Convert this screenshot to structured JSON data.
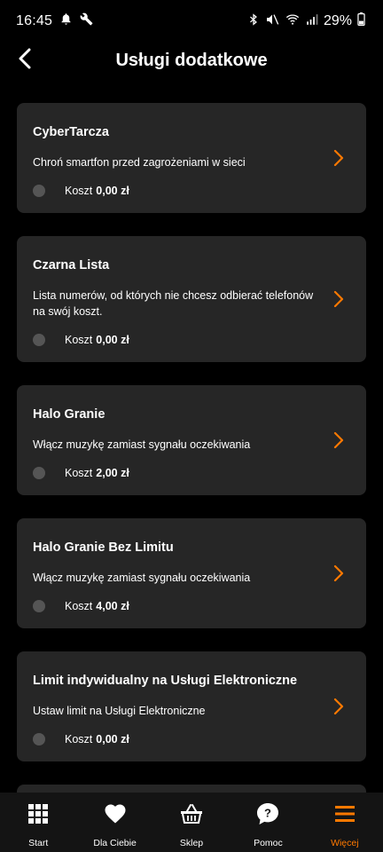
{
  "status_bar": {
    "time": "16:45",
    "battery": "29%"
  },
  "header": {
    "title": "Usługi dodatkowe"
  },
  "services": [
    {
      "title": "CyberTarcza",
      "description": "Chroń smartfon przed zagrożeniami w sieci",
      "cost_label": "Koszt",
      "cost_value": "0,00 zł"
    },
    {
      "title": "Czarna Lista",
      "description": "Lista numerów, od których nie chcesz odbierać telefonów na swój koszt.",
      "cost_label": "Koszt",
      "cost_value": "0,00 zł"
    },
    {
      "title": "Halo Granie",
      "description": "Włącz muzykę zamiast sygnału oczekiwania",
      "cost_label": "Koszt",
      "cost_value": "2,00 zł"
    },
    {
      "title": "Halo Granie Bez Limitu",
      "description": "Włącz muzykę zamiast sygnału oczekiwania",
      "cost_label": "Koszt",
      "cost_value": "4,00 zł"
    },
    {
      "title": "Limit indywidualny na Usługi Elektroniczne",
      "description": "Ustaw limit na Usługi Elektroniczne",
      "cost_label": "Koszt",
      "cost_value": "0,00 zł"
    }
  ],
  "bottom_nav": {
    "items": [
      {
        "label": "Start",
        "icon": "grid-icon"
      },
      {
        "label": "Dla Ciebie",
        "icon": "heart-icon"
      },
      {
        "label": "Sklep",
        "icon": "basket-icon"
      },
      {
        "label": "Pomoc",
        "icon": "help-bubble-icon"
      },
      {
        "label": "Więcej",
        "icon": "menu-icon"
      }
    ],
    "active_index": 4
  },
  "colors": {
    "accent": "#ff7900",
    "card_bg": "#262626",
    "background": "#000000",
    "nav_bg": "#141414"
  }
}
